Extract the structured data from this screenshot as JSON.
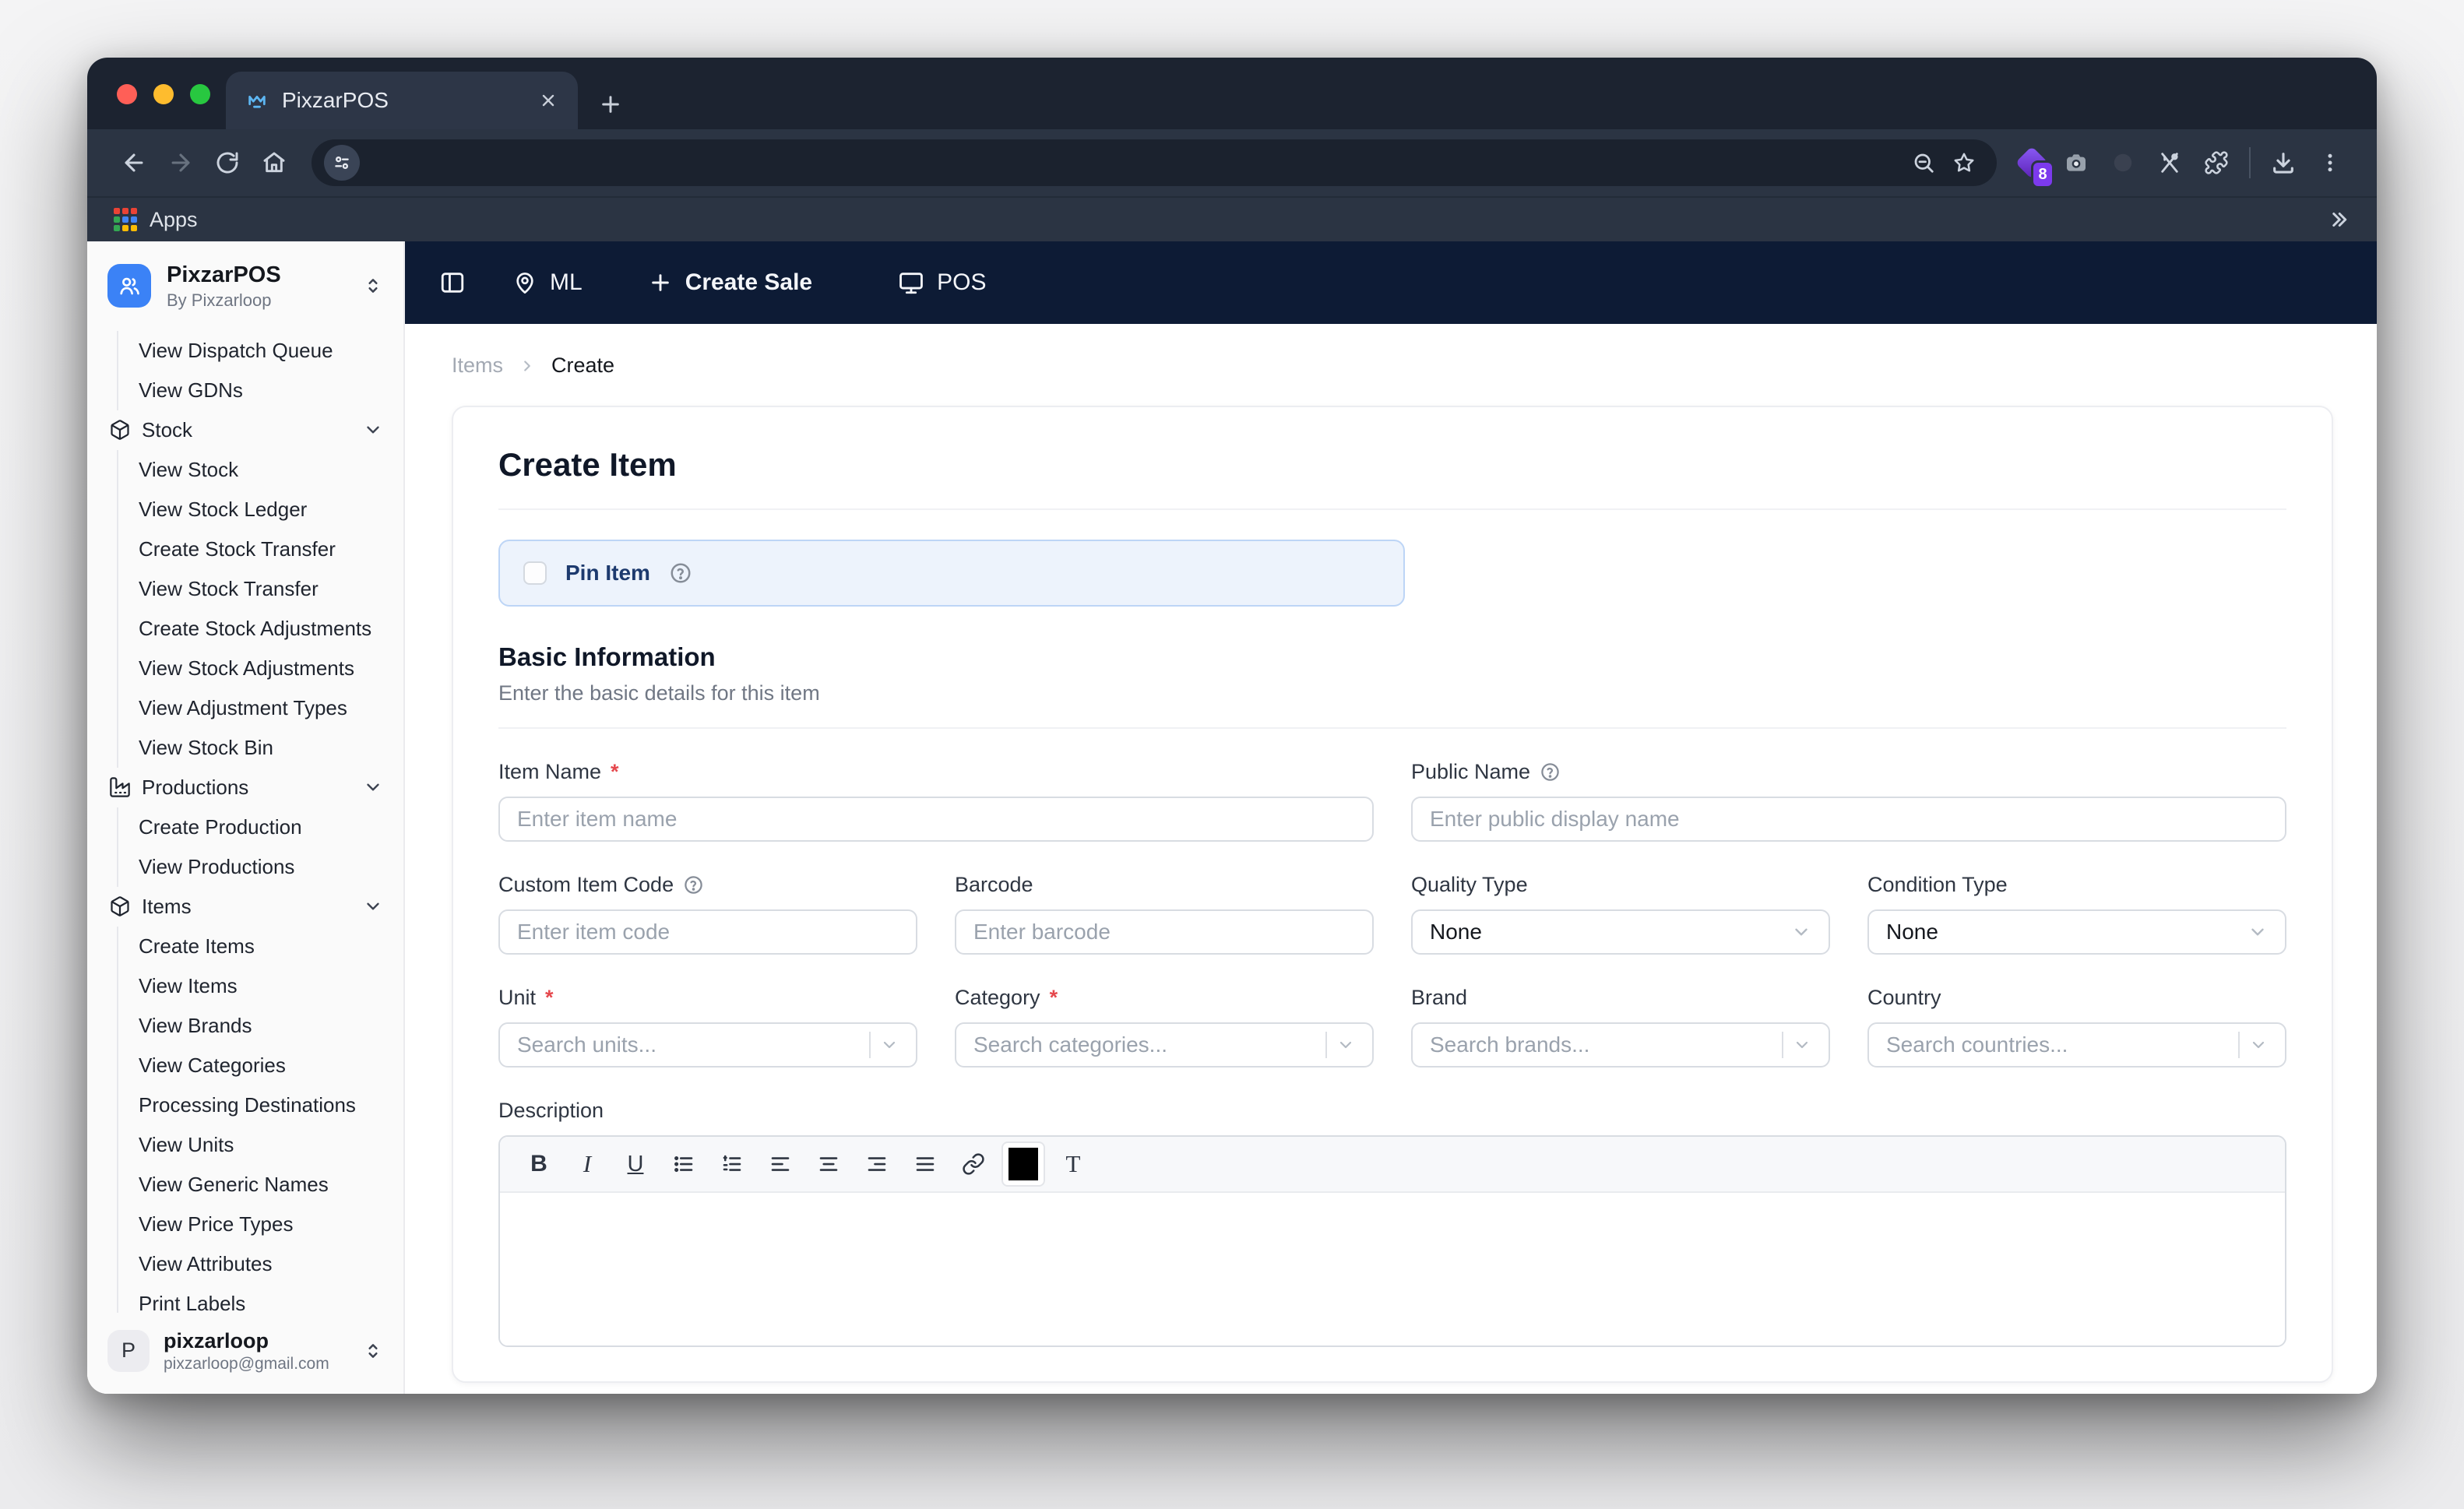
{
  "browser": {
    "tab": {
      "title": "PixzarPOS"
    },
    "bookmarks": {
      "apps_label": "Apps"
    },
    "extensions": {
      "badge": "8"
    }
  },
  "appbar": {
    "location_label": "ML",
    "create_sale_label": "Create Sale",
    "pos_label": "POS"
  },
  "sidebar": {
    "app": {
      "name": "PixzarPOS",
      "by": "By Pixzarloop"
    },
    "menu": [
      {
        "label": "View Dispatch Queue",
        "type": "sub"
      },
      {
        "label": "View GDNs",
        "type": "sub"
      },
      {
        "label": "Stock",
        "type": "section",
        "icon": "package-icon"
      },
      {
        "label": "View Stock",
        "type": "sub"
      },
      {
        "label": "View Stock Ledger",
        "type": "sub"
      },
      {
        "label": "Create Stock Transfer",
        "type": "sub"
      },
      {
        "label": "View Stock Transfer",
        "type": "sub"
      },
      {
        "label": "Create Stock Adjustments",
        "type": "sub"
      },
      {
        "label": "View Stock Adjustments",
        "type": "sub"
      },
      {
        "label": "View Adjustment Types",
        "type": "sub"
      },
      {
        "label": "View Stock Bin",
        "type": "sub"
      },
      {
        "label": "Productions",
        "type": "section",
        "icon": "factory-icon"
      },
      {
        "label": "Create Production",
        "type": "sub"
      },
      {
        "label": "View Productions",
        "type": "sub"
      },
      {
        "label": "Items",
        "type": "section",
        "icon": "package-icon"
      },
      {
        "label": "Create Items",
        "type": "sub"
      },
      {
        "label": "View Items",
        "type": "sub"
      },
      {
        "label": "View Brands",
        "type": "sub"
      },
      {
        "label": "View Categories",
        "type": "sub"
      },
      {
        "label": "Processing Destinations",
        "type": "sub"
      },
      {
        "label": "View Units",
        "type": "sub"
      },
      {
        "label": "View Generic Names",
        "type": "sub"
      },
      {
        "label": "View Price Types",
        "type": "sub"
      },
      {
        "label": "View Attributes",
        "type": "sub"
      },
      {
        "label": "Print Labels",
        "type": "sub"
      }
    ],
    "user": {
      "initial": "P",
      "name": "pixzarloop",
      "email": "pixzarloop@gmail.com"
    }
  },
  "breadcrumb": {
    "parent": "Items",
    "current": "Create"
  },
  "page": {
    "title": "Create Item",
    "required_marker": "*",
    "pin": {
      "label": "Pin Item"
    },
    "basic": {
      "title": "Basic Information",
      "subtitle": "Enter the basic details for this item"
    },
    "fields": {
      "item_name": {
        "label": "Item Name",
        "placeholder": "Enter item name",
        "required": true
      },
      "public_name": {
        "label": "Public Name",
        "placeholder": "Enter public display name"
      },
      "custom_item_code": {
        "label": "Custom Item Code",
        "placeholder": "Enter item code"
      },
      "barcode": {
        "label": "Barcode",
        "placeholder": "Enter barcode"
      },
      "quality_type": {
        "label": "Quality Type",
        "value": "None"
      },
      "condition_type": {
        "label": "Condition Type",
        "value": "None"
      },
      "unit": {
        "label": "Unit",
        "placeholder": "Search units...",
        "required": true
      },
      "category": {
        "label": "Category",
        "placeholder": "Search categories...",
        "required": true
      },
      "brand": {
        "label": "Brand",
        "placeholder": "Search brands..."
      },
      "country": {
        "label": "Country",
        "placeholder": "Search countries..."
      }
    },
    "description": {
      "label": "Description",
      "tools": [
        "bold",
        "italic",
        "underline",
        "bullet-list",
        "ordered-list",
        "align-left",
        "align-center",
        "align-right",
        "align-justify",
        "link",
        "color-swatch",
        "text-style"
      ],
      "color_swatch": "#000000"
    }
  },
  "colors": {
    "accent_blue": "#3b82f6",
    "navy_bar": "#0d1b35",
    "pin_bg": "#edf3fc",
    "pin_border": "#bdd5f6",
    "pin_text": "#1d3a6e",
    "required": "#e5484d"
  }
}
